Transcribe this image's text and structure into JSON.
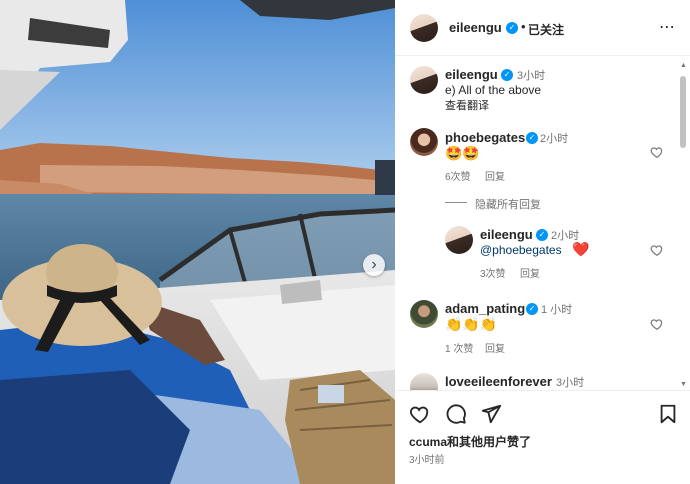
{
  "header": {
    "username": "eileengu",
    "dot": "•",
    "follow_state": "已关注",
    "more_icon": "more-horizontal-icon"
  },
  "caption": {
    "username": "eileengu",
    "time": "3小时",
    "text": "e) All of the above",
    "translate": "查看翻译"
  },
  "comments": [
    {
      "username": "phoebegates",
      "time": "2小时",
      "emoji": "🤩🤩",
      "likes": "6次赞",
      "reply": "回复"
    },
    {
      "hide_replies": "隐藏所有回复"
    },
    {
      "username": "eileengu",
      "time": "2小时",
      "mention": "@phoebegates",
      "emoji": "❤️",
      "likes": "3次赞",
      "reply": "回复"
    },
    {
      "username": "adam_pating",
      "time": "1 小时",
      "emoji": "👏👏👏",
      "likes": "1 次赞",
      "reply": "回复"
    },
    {
      "username": "loveeileenforever",
      "time": "3小时"
    }
  ],
  "actions": {
    "likes_text": "ccuma和其他用户赞了",
    "posted_time": "3小时前",
    "icons": [
      "heart-icon",
      "comment-icon",
      "share-icon",
      "bookmark-icon"
    ]
  },
  "colors": {
    "verified": "#0095f6",
    "mention": "#00376b",
    "secondary_text": "#737373"
  }
}
